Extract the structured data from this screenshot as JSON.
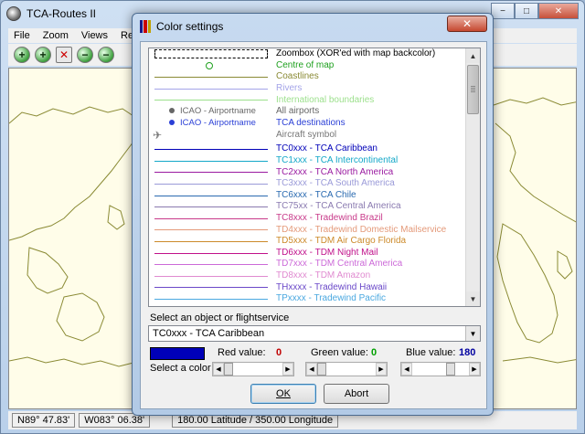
{
  "app": {
    "title": "TCA-Routes II",
    "menu": [
      "File",
      "Zoom",
      "Views",
      "Reg"
    ],
    "toolbar": [
      {
        "icon": "zoom-in-icon",
        "glyph": "+"
      },
      {
        "icon": "zoom-in-icon",
        "glyph": "+"
      },
      {
        "icon": "zoom-cancel-icon",
        "glyph": "✕"
      },
      {
        "icon": "zoom-out-icon",
        "glyph": "−"
      },
      {
        "icon": "zoom-out-icon",
        "glyph": "−"
      }
    ],
    "status": {
      "lat": "N89° 47.83'",
      "lon": "W083° 06.38'",
      "extent": "180.00  Latitude / 350.00  Longitude"
    },
    "window_buttons": {
      "minimize": "−",
      "maximize": "□",
      "close": "✕"
    }
  },
  "dialog": {
    "title": "Color settings",
    "close_glyph": "✕",
    "items": [
      {
        "kind": "zoombox",
        "label": "Zoombox (XOR'ed with map backcolor)",
        "color": "#000000"
      },
      {
        "kind": "circle",
        "label": "Centre of map",
        "color": "#1ea01e"
      },
      {
        "kind": "line",
        "label": "Coastlines",
        "color": "#8a8a34"
      },
      {
        "kind": "line",
        "label": "Rivers",
        "color": "#a4a4e8"
      },
      {
        "kind": "line",
        "label": "International boundaries",
        "color": "#9ce08c"
      },
      {
        "kind": "airport",
        "label": "All airports",
        "sample": "ICAO - Airportname",
        "color": "#666666"
      },
      {
        "kind": "airport",
        "label": "TCA destinations",
        "sample": "ICAO - Airportname",
        "color": "#2a3fd6"
      },
      {
        "kind": "aircraft",
        "label": "Aircraft symbol",
        "color": "#777777"
      },
      {
        "kind": "line",
        "label": "TC0xxx - TCA Caribbean",
        "color": "#0000b8"
      },
      {
        "kind": "line",
        "label": "TC1xxx - TCA Intercontinental",
        "color": "#14a8c8"
      },
      {
        "kind": "line",
        "label": "TC2xxx - TCA North America",
        "color": "#9a1aa0"
      },
      {
        "kind": "line",
        "label": "TC3xxx - TCA South America",
        "color": "#9a9ad8"
      },
      {
        "kind": "line",
        "label": "TC6xxx - TCA Chile",
        "color": "#2a6ab0"
      },
      {
        "kind": "line",
        "label": "TC75xx - TCA Central America",
        "color": "#8a7ab0"
      },
      {
        "kind": "line",
        "label": "TC8xxx - Tradewind Brazil",
        "color": "#c83a8a"
      },
      {
        "kind": "line",
        "label": "TD4xxx - Tradewind Domestic Mailservice",
        "color": "#e49a7a"
      },
      {
        "kind": "line",
        "label": "TD5xxx - TDM Air Cargo Florida",
        "color": "#cc8a2a"
      },
      {
        "kind": "line",
        "label": "TD6xxx - TDM Night Mail",
        "color": "#c0108a"
      },
      {
        "kind": "line",
        "label": "TD7xxx - TDM Central America",
        "color": "#cc6ad8"
      },
      {
        "kind": "line",
        "label": "TD8xxx - TDM Amazon",
        "color": "#e08ad0"
      },
      {
        "kind": "line",
        "label": "THxxxx - Tradewind Hawaii",
        "color": "#6a48c8"
      },
      {
        "kind": "line",
        "label": "TPxxxx - Tradewind Pacific",
        "color": "#4aa8e0"
      },
      {
        "kind": "line",
        "label": "",
        "color": "#3a78a8"
      }
    ],
    "select_label": "Select an object or flightservice",
    "selected": "TC0xxx - TCA Caribbean",
    "swatch_color": "#0000b8",
    "select_color_label": "Select a color",
    "red": {
      "label": "Red value:",
      "value": "0",
      "color": "#c00000",
      "fraction": 0.0
    },
    "green": {
      "label": "Green value:",
      "value": "0",
      "color": "#00a000",
      "fraction": 0.0
    },
    "blue": {
      "label": "Blue value:",
      "value": "180",
      "color": "#0000a0",
      "fraction": 0.706
    },
    "ok_label": "OK",
    "abort_label": "Abort"
  }
}
